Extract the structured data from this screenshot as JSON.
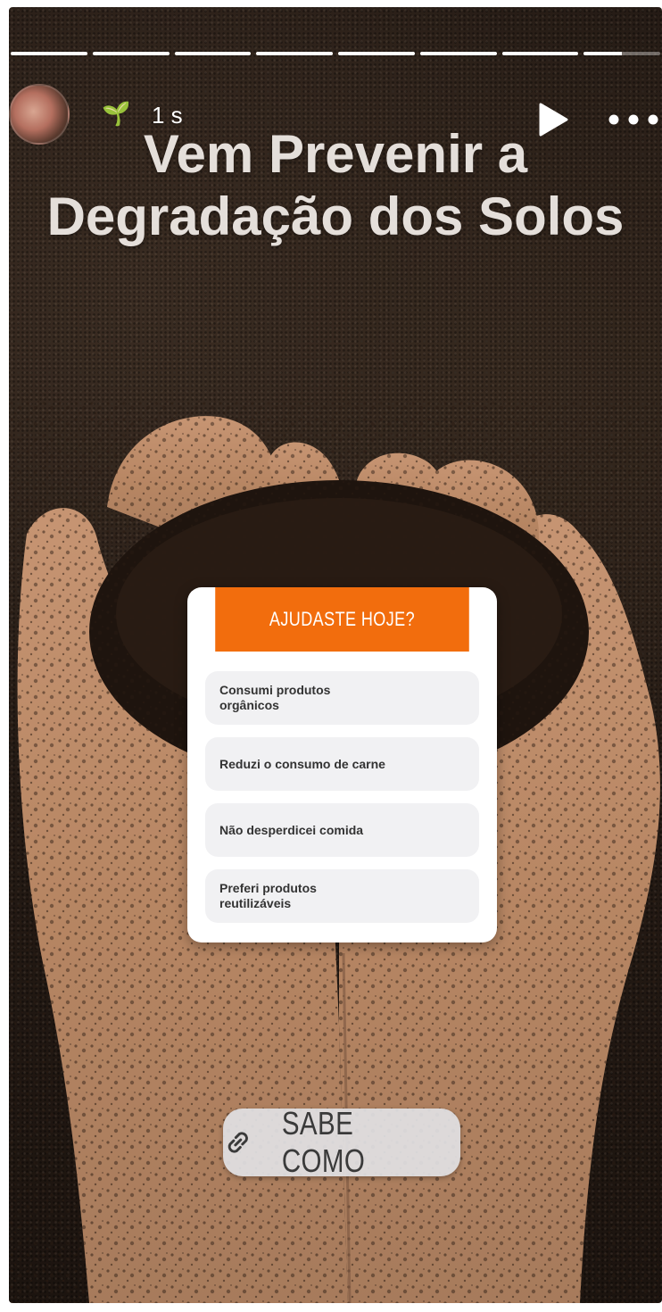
{
  "story": {
    "progress_segments": [
      1,
      1,
      1,
      1,
      1,
      1,
      1,
      0.5
    ],
    "time": "1 s",
    "header_emoji": "🌱",
    "title": "Vem Prevenir a Degradação dos Solos",
    "icons": {
      "play": "play-icon",
      "more": "more-icon",
      "link": "link-icon"
    }
  },
  "poll": {
    "question": "AJUDASTE HOJE?",
    "accent_color": "#f26d0d",
    "options": [
      "Consumi produtos orgânicos",
      "Reduzi o consumo de carne",
      "Não desperdicei comida",
      "Preferi produtos reutilizáveis"
    ]
  },
  "link_sticker": {
    "label": "SABE COMO"
  }
}
